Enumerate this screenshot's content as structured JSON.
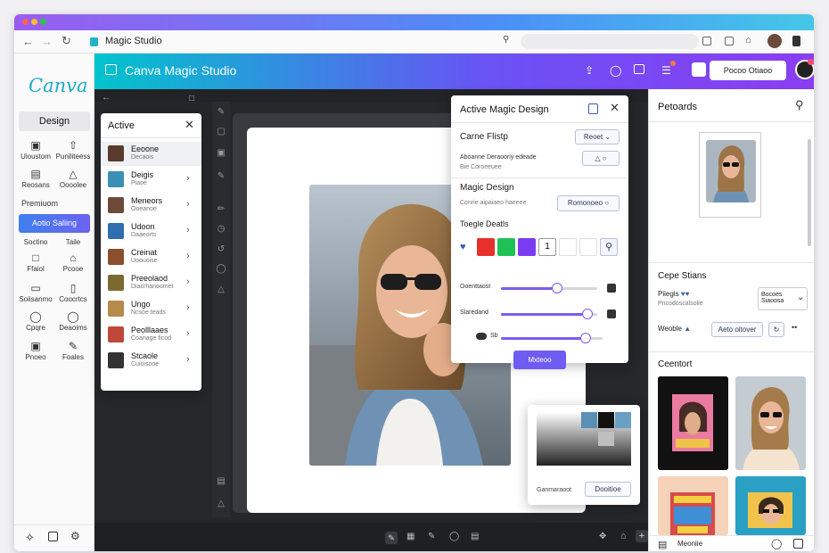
{
  "colors": {
    "accent": "#6a52f5",
    "primary_button": "#6f5cf3",
    "header_start": "#00c4cc",
    "header_end": "#8b3df2"
  },
  "browser": {
    "tab_title": "Magic Studio"
  },
  "header": {
    "app_title": "Canva Magic Studio",
    "account_button": "Pocoo Otiaoo"
  },
  "sidebar": {
    "logo": "Canva",
    "design_label": "Design",
    "items": [
      {
        "label": "Uioustom",
        "icon": "layout-icon"
      },
      {
        "label": "Puniliteess",
        "icon": "upload-icon"
      },
      {
        "label": "Reosans",
        "icon": "folder-icon"
      },
      {
        "label": "Oooolee",
        "icon": "shapes-icon"
      }
    ],
    "section_label": "Premiuom",
    "cta_button": "Aotio Saliing",
    "items2": [
      {
        "label": "Soctino",
        "icon": ""
      },
      {
        "label": "Taile",
        "icon": ""
      },
      {
        "label": "Ffaiol",
        "icon": "frame-icon"
      },
      {
        "label": "Pcooe",
        "icon": "house-icon"
      },
      {
        "label": "Soiisanmo",
        "icon": "doc-icon"
      },
      {
        "label": "Coocrtcs",
        "icon": "file-icon"
      },
      {
        "label": "Cpqre",
        "icon": "bulb-icon"
      },
      {
        "label": "Deaoims",
        "icon": "bulb-icon"
      },
      {
        "label": "Pnoeo",
        "icon": "photo-icon"
      },
      {
        "label": "Foales",
        "icon": "brush-icon"
      }
    ]
  },
  "layers": {
    "title": "Active",
    "items": [
      {
        "name": "Eeoone",
        "sub": "Decaois"
      },
      {
        "name": "Deigis",
        "sub": "Piaoe"
      },
      {
        "name": "Meneors",
        "sub": "Ooeanoe"
      },
      {
        "name": "Udoon",
        "sub": "Daaeorts"
      },
      {
        "name": "Creinat",
        "sub": "Uoouoise"
      },
      {
        "name": "Preeolaod",
        "sub": "Diacrhanoomet"
      },
      {
        "name": "Ungo",
        "sub": "Ncsoe teads"
      },
      {
        "name": "Peolllaaes",
        "sub": "Coanage ficod"
      },
      {
        "name": "Stcaole",
        "sub": "Cuioisooe"
      }
    ]
  },
  "magic": {
    "title": "Active Magic Design",
    "canvas_label": "Carne Flistp",
    "reset_button": "Reoet",
    "desc_line1": "Aboanne Deraooriy edeade",
    "desc_line2": "Bie Coroeeuee",
    "magic_design_label": "Magic Design",
    "magic_sub": "Conrie aipaiaeo haeeee",
    "remove_button": "Romonoeo",
    "toggle_label": "Toegle Deatls",
    "stepper_value": "1",
    "slider1_label": "Ooenttaost",
    "slider1_value": 0.58,
    "slider2_label": "Slaredand",
    "slider2_value": 0.9,
    "slider3_label": "Sb",
    "slider3_value": 0.83,
    "apply_button": "Mxteoo",
    "swatch_colors": [
      "#e8302a",
      "#1fc156",
      "#7a3cf0"
    ]
  },
  "colorpicker": {
    "left_label": "Ganmaraoot",
    "right_button": "Dooitioe"
  },
  "right": {
    "title": "Petoards",
    "section2": "Cepe Stians",
    "label_a": "Piiegis",
    "label_a_sub": "Pncodoscalsolie",
    "dropdown": "Bocoes Siaoosa",
    "pill_label": "Weoble",
    "pill_button": "Aeto oitover",
    "section3": "Ceentort",
    "footer_label": "Meoniie"
  },
  "bottom_tools": [
    "pen-icon",
    "grid-icon",
    "brush-icon",
    "circle-icon",
    "copy-icon"
  ]
}
